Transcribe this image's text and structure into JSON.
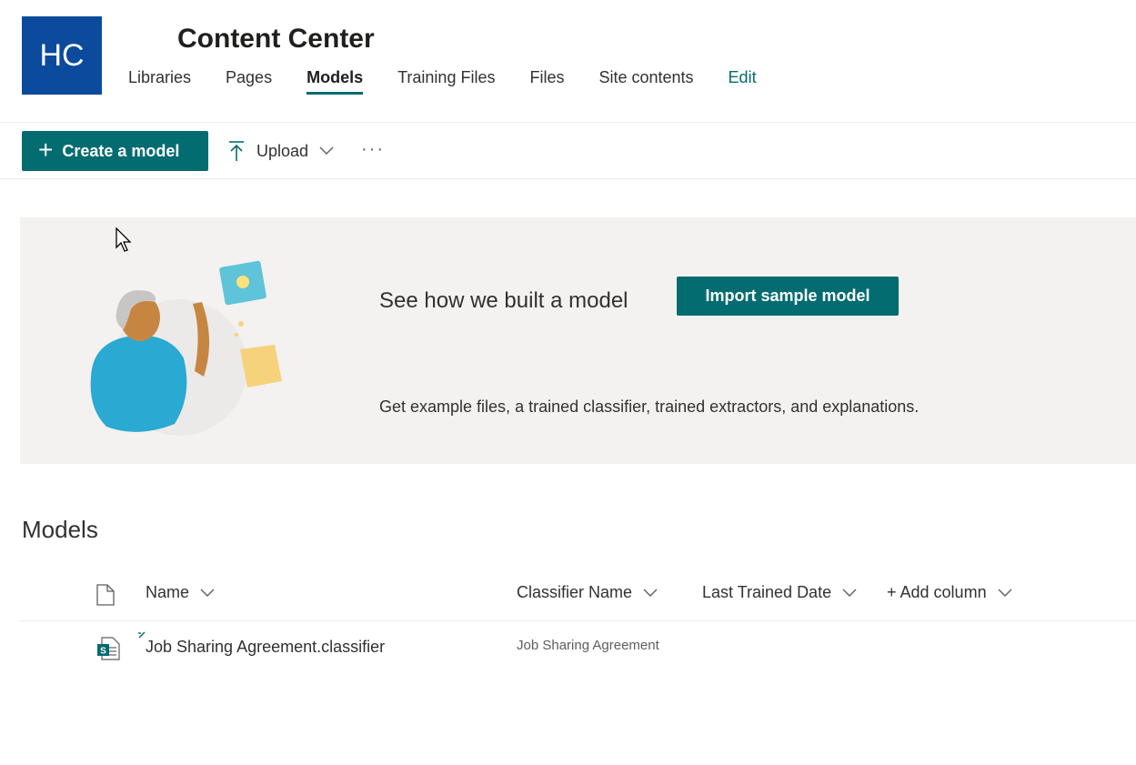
{
  "header": {
    "logo_text": "HC",
    "site_title": "Content Center",
    "nav": [
      {
        "label": "Libraries"
      },
      {
        "label": "Pages"
      },
      {
        "label": "Models"
      },
      {
        "label": "Training Files"
      },
      {
        "label": "Files"
      },
      {
        "label": "Site contents"
      },
      {
        "label": "Edit"
      }
    ],
    "active_nav": "Models"
  },
  "command_bar": {
    "create_label": "Create a model",
    "upload_label": "Upload",
    "more_label": "···"
  },
  "banner": {
    "heading": "See how we built a model",
    "button_label": "Import sample model",
    "description": "Get example files, a trained classifier, trained extractors, and explanations."
  },
  "models": {
    "section_title": "Models",
    "columns": {
      "name": "Name",
      "classifier": "Classifier Name",
      "last_trained": "Last Trained Date",
      "add_column": "+ Add column"
    },
    "rows": [
      {
        "name": "Job Sharing Agreement.classifier",
        "classifier": "Job Sharing Agreement",
        "last_trained": ""
      }
    ]
  },
  "colors": {
    "accent": "#036c70",
    "logo_bg": "#0b4a9c",
    "banner_bg": "#f3f2f1"
  },
  "icons": [
    "plus-icon",
    "upload-icon",
    "chevron-down-icon",
    "more-icon",
    "document-icon",
    "sharepoint-file-icon",
    "new-item-icon"
  ]
}
